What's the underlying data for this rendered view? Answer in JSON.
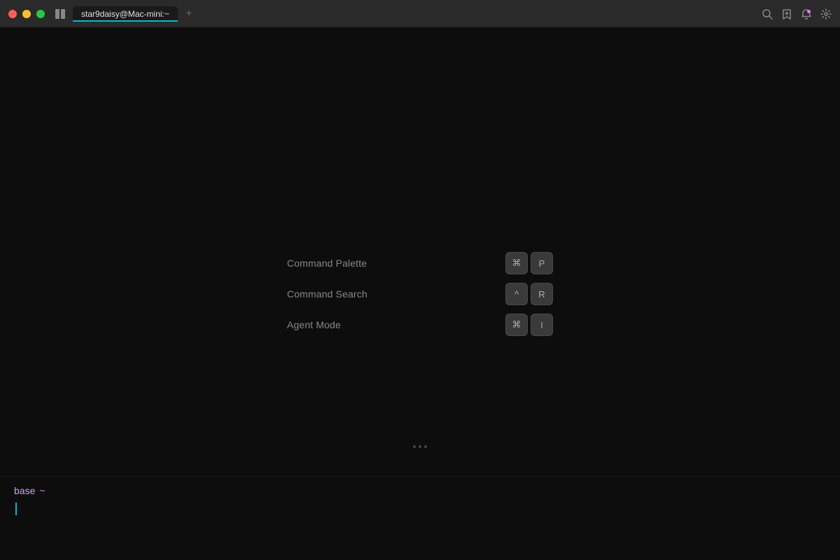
{
  "titlebar": {
    "tab_title": "star9daisy@Mac-mini:~",
    "new_tab_label": "+",
    "traffic_lights": {
      "close_color": "#ff5f57",
      "minimize_color": "#ffbd2e",
      "maximize_color": "#28c840"
    }
  },
  "command_menu": {
    "items": [
      {
        "label": "Command Palette",
        "keys": [
          "⌘",
          "P"
        ]
      },
      {
        "label": "Command Search",
        "keys": [
          "^",
          "R"
        ]
      },
      {
        "label": "Agent Mode",
        "keys": [
          "⌘",
          "I"
        ]
      }
    ]
  },
  "terminal": {
    "prompt_base": "base",
    "prompt_tilde": "~",
    "dots": [
      "•",
      "•",
      "•"
    ]
  },
  "icons": {
    "search": "🔍",
    "bookmark": "📌",
    "bell": "🔔",
    "settings": "⚙"
  }
}
